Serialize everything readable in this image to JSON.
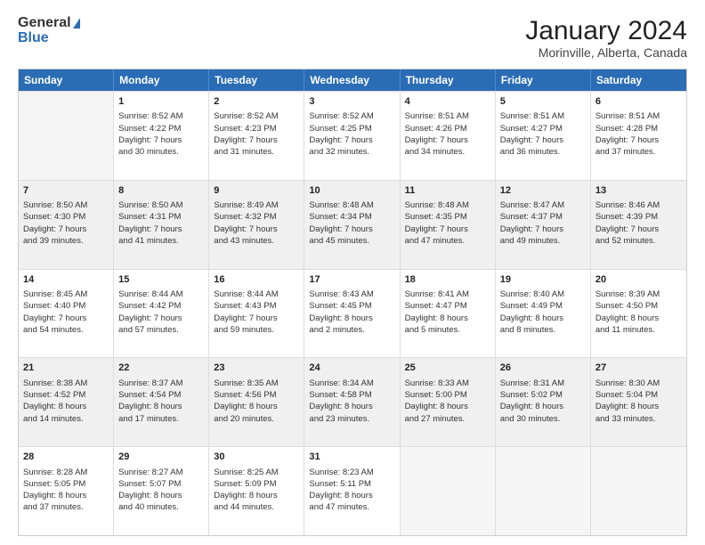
{
  "logo": {
    "general": "General",
    "blue": "Blue"
  },
  "title": "January 2024",
  "subtitle": "Morinville, Alberta, Canada",
  "header_days": [
    "Sunday",
    "Monday",
    "Tuesday",
    "Wednesday",
    "Thursday",
    "Friday",
    "Saturday"
  ],
  "weeks": [
    [
      {
        "day": "",
        "lines": [],
        "empty": true
      },
      {
        "day": "1",
        "lines": [
          "Sunrise: 8:52 AM",
          "Sunset: 4:22 PM",
          "Daylight: 7 hours",
          "and 30 minutes."
        ],
        "shaded": false
      },
      {
        "day": "2",
        "lines": [
          "Sunrise: 8:52 AM",
          "Sunset: 4:23 PM",
          "Daylight: 7 hours",
          "and 31 minutes."
        ],
        "shaded": false
      },
      {
        "day": "3",
        "lines": [
          "Sunrise: 8:52 AM",
          "Sunset: 4:25 PM",
          "Daylight: 7 hours",
          "and 32 minutes."
        ],
        "shaded": false
      },
      {
        "day": "4",
        "lines": [
          "Sunrise: 8:51 AM",
          "Sunset: 4:26 PM",
          "Daylight: 7 hours",
          "and 34 minutes."
        ],
        "shaded": false
      },
      {
        "day": "5",
        "lines": [
          "Sunrise: 8:51 AM",
          "Sunset: 4:27 PM",
          "Daylight: 7 hours",
          "and 36 minutes."
        ],
        "shaded": false
      },
      {
        "day": "6",
        "lines": [
          "Sunrise: 8:51 AM",
          "Sunset: 4:28 PM",
          "Daylight: 7 hours",
          "and 37 minutes."
        ],
        "shaded": false
      }
    ],
    [
      {
        "day": "7",
        "lines": [
          "Sunrise: 8:50 AM",
          "Sunset: 4:30 PM",
          "Daylight: 7 hours",
          "and 39 minutes."
        ],
        "shaded": true
      },
      {
        "day": "8",
        "lines": [
          "Sunrise: 8:50 AM",
          "Sunset: 4:31 PM",
          "Daylight: 7 hours",
          "and 41 minutes."
        ],
        "shaded": true
      },
      {
        "day": "9",
        "lines": [
          "Sunrise: 8:49 AM",
          "Sunset: 4:32 PM",
          "Daylight: 7 hours",
          "and 43 minutes."
        ],
        "shaded": true
      },
      {
        "day": "10",
        "lines": [
          "Sunrise: 8:48 AM",
          "Sunset: 4:34 PM",
          "Daylight: 7 hours",
          "and 45 minutes."
        ],
        "shaded": true
      },
      {
        "day": "11",
        "lines": [
          "Sunrise: 8:48 AM",
          "Sunset: 4:35 PM",
          "Daylight: 7 hours",
          "and 47 minutes."
        ],
        "shaded": true
      },
      {
        "day": "12",
        "lines": [
          "Sunrise: 8:47 AM",
          "Sunset: 4:37 PM",
          "Daylight: 7 hours",
          "and 49 minutes."
        ],
        "shaded": true
      },
      {
        "day": "13",
        "lines": [
          "Sunrise: 8:46 AM",
          "Sunset: 4:39 PM",
          "Daylight: 7 hours",
          "and 52 minutes."
        ],
        "shaded": true
      }
    ],
    [
      {
        "day": "14",
        "lines": [
          "Sunrise: 8:45 AM",
          "Sunset: 4:40 PM",
          "Daylight: 7 hours",
          "and 54 minutes."
        ],
        "shaded": false
      },
      {
        "day": "15",
        "lines": [
          "Sunrise: 8:44 AM",
          "Sunset: 4:42 PM",
          "Daylight: 7 hours",
          "and 57 minutes."
        ],
        "shaded": false
      },
      {
        "day": "16",
        "lines": [
          "Sunrise: 8:44 AM",
          "Sunset: 4:43 PM",
          "Daylight: 7 hours",
          "and 59 minutes."
        ],
        "shaded": false
      },
      {
        "day": "17",
        "lines": [
          "Sunrise: 8:43 AM",
          "Sunset: 4:45 PM",
          "Daylight: 8 hours",
          "and 2 minutes."
        ],
        "shaded": false
      },
      {
        "day": "18",
        "lines": [
          "Sunrise: 8:41 AM",
          "Sunset: 4:47 PM",
          "Daylight: 8 hours",
          "and 5 minutes."
        ],
        "shaded": false
      },
      {
        "day": "19",
        "lines": [
          "Sunrise: 8:40 AM",
          "Sunset: 4:49 PM",
          "Daylight: 8 hours",
          "and 8 minutes."
        ],
        "shaded": false
      },
      {
        "day": "20",
        "lines": [
          "Sunrise: 8:39 AM",
          "Sunset: 4:50 PM",
          "Daylight: 8 hours",
          "and 11 minutes."
        ],
        "shaded": false
      }
    ],
    [
      {
        "day": "21",
        "lines": [
          "Sunrise: 8:38 AM",
          "Sunset: 4:52 PM",
          "Daylight: 8 hours",
          "and 14 minutes."
        ],
        "shaded": true
      },
      {
        "day": "22",
        "lines": [
          "Sunrise: 8:37 AM",
          "Sunset: 4:54 PM",
          "Daylight: 8 hours",
          "and 17 minutes."
        ],
        "shaded": true
      },
      {
        "day": "23",
        "lines": [
          "Sunrise: 8:35 AM",
          "Sunset: 4:56 PM",
          "Daylight: 8 hours",
          "and 20 minutes."
        ],
        "shaded": true
      },
      {
        "day": "24",
        "lines": [
          "Sunrise: 8:34 AM",
          "Sunset: 4:58 PM",
          "Daylight: 8 hours",
          "and 23 minutes."
        ],
        "shaded": true
      },
      {
        "day": "25",
        "lines": [
          "Sunrise: 8:33 AM",
          "Sunset: 5:00 PM",
          "Daylight: 8 hours",
          "and 27 minutes."
        ],
        "shaded": true
      },
      {
        "day": "26",
        "lines": [
          "Sunrise: 8:31 AM",
          "Sunset: 5:02 PM",
          "Daylight: 8 hours",
          "and 30 minutes."
        ],
        "shaded": true
      },
      {
        "day": "27",
        "lines": [
          "Sunrise: 8:30 AM",
          "Sunset: 5:04 PM",
          "Daylight: 8 hours",
          "and 33 minutes."
        ],
        "shaded": true
      }
    ],
    [
      {
        "day": "28",
        "lines": [
          "Sunrise: 8:28 AM",
          "Sunset: 5:05 PM",
          "Daylight: 8 hours",
          "and 37 minutes."
        ],
        "shaded": false
      },
      {
        "day": "29",
        "lines": [
          "Sunrise: 8:27 AM",
          "Sunset: 5:07 PM",
          "Daylight: 8 hours",
          "and 40 minutes."
        ],
        "shaded": false
      },
      {
        "day": "30",
        "lines": [
          "Sunrise: 8:25 AM",
          "Sunset: 5:09 PM",
          "Daylight: 8 hours",
          "and 44 minutes."
        ],
        "shaded": false
      },
      {
        "day": "31",
        "lines": [
          "Sunrise: 8:23 AM",
          "Sunset: 5:11 PM",
          "Daylight: 8 hours",
          "and 47 minutes."
        ],
        "shaded": false
      },
      {
        "day": "",
        "lines": [],
        "empty": true
      },
      {
        "day": "",
        "lines": [],
        "empty": true
      },
      {
        "day": "",
        "lines": [],
        "empty": true
      }
    ]
  ]
}
